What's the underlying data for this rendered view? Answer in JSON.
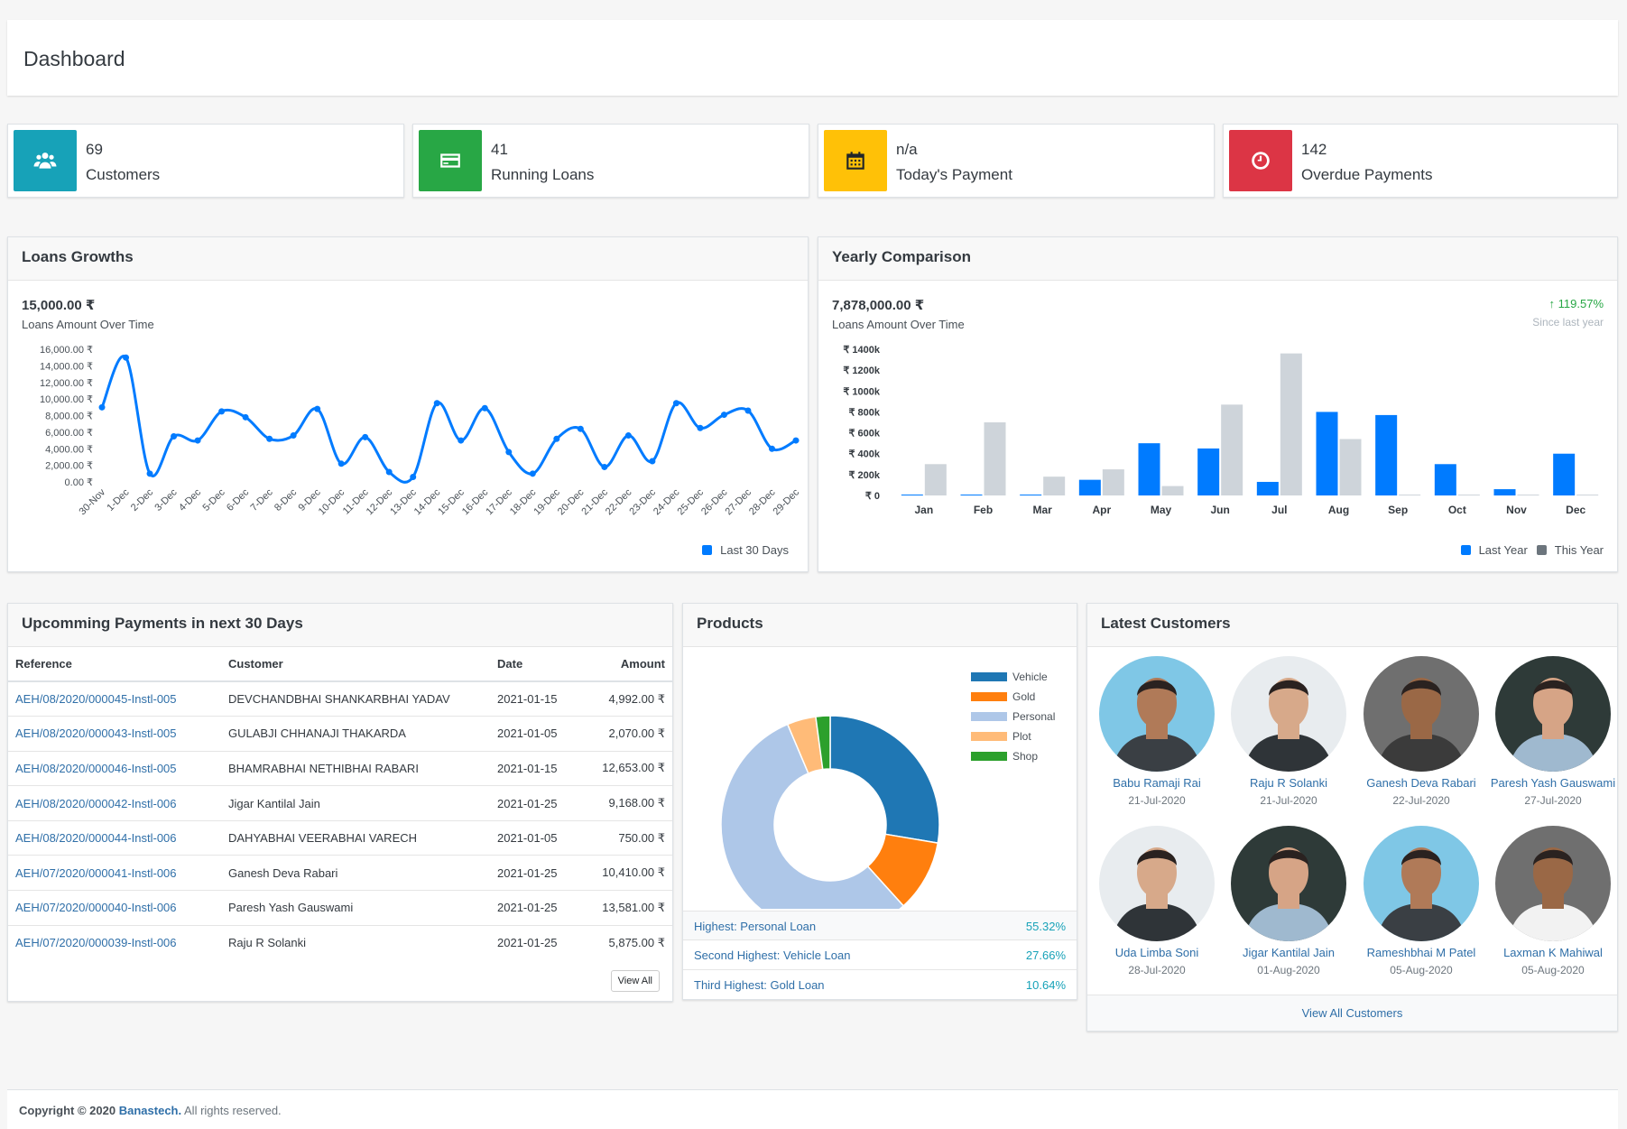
{
  "page": {
    "title": "Dashboard"
  },
  "info_boxes": [
    {
      "value": "69",
      "label": "Customers",
      "color": "#17a2b8",
      "icon": "users-icon"
    },
    {
      "value": "41",
      "label": "Running Loans",
      "color": "#28a745",
      "icon": "credit-card-icon"
    },
    {
      "value": "n/a",
      "label": "Today's Payment",
      "color": "#ffc107",
      "icon": "calendar-icon"
    },
    {
      "value": "142",
      "label": "Overdue Payments",
      "color": "#dc3545",
      "icon": "clock-icon"
    }
  ],
  "loans_growth": {
    "title": "Loans Growths",
    "value": "15,000.00 ₹",
    "subtitle": "Loans Amount Over Time",
    "legend": "Last 30 Days",
    "chart_data": {
      "type": "line",
      "series": [
        {
          "name": "Last 30 Days",
          "color": "#007bff",
          "values": [
            9000,
            15000,
            1000,
            5500,
            5000,
            8500,
            7800,
            5200,
            5600,
            8800,
            2200,
            5400,
            1200,
            600,
            9500,
            5000,
            8900,
            3600,
            1000,
            5200,
            6400,
            1800,
            5600,
            2500,
            9500,
            6500,
            8100,
            8600,
            4000,
            5000
          ]
        }
      ],
      "categories": [
        "30-Nov",
        "1-Dec",
        "2-Dec",
        "3-Dec",
        "4-Dec",
        "5-Dec",
        "6-Dec",
        "7-Dec",
        "8-Dec",
        "9-Dec",
        "10-Dec",
        "11-Dec",
        "12-Dec",
        "13-Dec",
        "14-Dec",
        "15-Dec",
        "16-Dec",
        "17-Dec",
        "18-Dec",
        "19-Dec",
        "20-Dec",
        "21-Dec",
        "22-Dec",
        "23-Dec",
        "24-Dec",
        "25-Dec",
        "26-Dec",
        "27-Dec",
        "28-Dec",
        "29-Dec"
      ],
      "y_ticks": [
        "16,000.00 ₹",
        "14,000.00 ₹",
        "12,000.00 ₹",
        "10,000.00 ₹",
        "8,000.00 ₹",
        "6,000.00 ₹",
        "4,000.00 ₹",
        "2,000.00 ₹",
        "0.00 ₹"
      ],
      "ylim": [
        0,
        16000
      ]
    }
  },
  "yearly": {
    "title": "Yearly Comparison",
    "value": "7,878,000.00 ₹",
    "subtitle": "Loans Amount Over Time",
    "change": "119.57%",
    "change_label": "Since last year",
    "legend": [
      "Last Year",
      "This Year"
    ],
    "chart_data": {
      "type": "bar",
      "categories": [
        "Jan",
        "Feb",
        "Mar",
        "Apr",
        "May",
        "Jun",
        "Jul",
        "Aug",
        "Sep",
        "Oct",
        "Nov",
        "Dec"
      ],
      "series": [
        {
          "name": "Last Year",
          "color": "#007bff",
          "values": [
            0,
            0,
            0,
            150,
            500,
            450,
            130,
            800,
            770,
            300,
            60,
            400
          ]
        },
        {
          "name": "This Year",
          "color": "#ced4da",
          "values": [
            300,
            700,
            180,
            250,
            90,
            870,
            1360,
            540,
            0,
            0,
            0,
            0
          ]
        }
      ],
      "y_ticks": [
        "₹ 1400k",
        "₹ 1200k",
        "₹ 1000k",
        "₹ 800k",
        "₹ 600k",
        "₹ 400k",
        "₹ 200k",
        "₹ 0"
      ],
      "ylim": [
        0,
        1400
      ]
    }
  },
  "payments": {
    "title": "Upcomming Payments in next 30 Days",
    "columns": [
      "Reference",
      "Customer",
      "Date",
      "Amount"
    ],
    "rows": [
      [
        "AEH/08/2020/000045-Instl-005",
        "DEVCHANDBHAI SHANKARBHAI YADAV",
        "2021-01-15",
        "4,992.00 ₹"
      ],
      [
        "AEH/08/2020/000043-Instl-005",
        "GULABJI CHHANAJI THAKARDA",
        "2021-01-05",
        "2,070.00 ₹"
      ],
      [
        "AEH/08/2020/000046-Instl-005",
        "BHAMRABHAI NETHIBHAI RABARI",
        "2021-01-15",
        "12,653.00 ₹"
      ],
      [
        "AEH/08/2020/000042-Instl-006",
        "Jigar Kantilal Jain",
        "2021-01-25",
        "9,168.00 ₹"
      ],
      [
        "AEH/08/2020/000044-Instl-006",
        "DAHYABHAI VEERABHAI VARECH",
        "2021-01-05",
        "750.00 ₹"
      ],
      [
        "AEH/07/2020/000041-Instl-006",
        "Ganesh Deva Rabari",
        "2021-01-25",
        "10,410.00 ₹"
      ],
      [
        "AEH/07/2020/000040-Instl-006",
        "Paresh Yash Gauswami",
        "2021-01-25",
        "13,581.00 ₹"
      ],
      [
        "AEH/07/2020/000039-Instl-006",
        "Raju R Solanki",
        "2021-01-25",
        "5,875.00 ₹"
      ]
    ],
    "view_all": "View All"
  },
  "products": {
    "title": "Products",
    "chart_data": {
      "type": "pie",
      "labels": [
        "Vehicle",
        "Gold",
        "Personal",
        "Plot",
        "Shop"
      ],
      "values": [
        27.66,
        10.64,
        55.32,
        4.26,
        2.12
      ],
      "colors": [
        "#1f77b4",
        "#ff7f0e",
        "#aec7e8",
        "#ffbb78",
        "#2ca02c"
      ]
    },
    "stats": [
      {
        "label": "Highest: Personal Loan",
        "value": "55.32%"
      },
      {
        "label": "Second Highest: Vehicle Loan",
        "value": "27.66%"
      },
      {
        "label": "Third Highest: Gold Loan",
        "value": "10.64%"
      }
    ]
  },
  "customers": {
    "title": "Latest Customers",
    "list": [
      {
        "name": "Babu Ramaji Rai",
        "date": "21-Jul-2020",
        "bg": "#7fc7e6",
        "skin": "#b07a58",
        "shirt": "#3a3f44"
      },
      {
        "name": "Raju R Solanki",
        "date": "21-Jul-2020",
        "bg": "#e8ecef",
        "skin": "#d7a98a",
        "shirt": "#2f3438"
      },
      {
        "name": "Ganesh Deva Rabari",
        "date": "22-Jul-2020",
        "bg": "#6f6f6f",
        "skin": "#9a6846",
        "shirt": "#3b3b3b"
      },
      {
        "name": "Paresh Yash Gauswami",
        "date": "27-Jul-2020",
        "bg": "#2e3a38",
        "skin": "#d6a486",
        "shirt": "#9fb9cf"
      },
      {
        "name": "Uda Limba Soni",
        "date": "28-Jul-2020",
        "bg": "#e8ecef",
        "skin": "#d7a98a",
        "shirt": "#2f3438"
      },
      {
        "name": "Jigar Kantilal Jain",
        "date": "01-Aug-2020",
        "bg": "#2e3a38",
        "skin": "#d6a486",
        "shirt": "#9fb9cf"
      },
      {
        "name": "Rameshbhai M Patel",
        "date": "05-Aug-2020",
        "bg": "#7fc7e6",
        "skin": "#b07a58",
        "shirt": "#3a3f44"
      },
      {
        "name": "Laxman K Mahiwal",
        "date": "05-Aug-2020",
        "bg": "#6f6f6f",
        "skin": "#9a6846",
        "shirt": "#f2f2f2"
      }
    ],
    "view_all": "View All Customers"
  },
  "footer": {
    "copyright": "Copyright © 2020",
    "brand": "Banastech.",
    "rights": "All rights reserved."
  }
}
